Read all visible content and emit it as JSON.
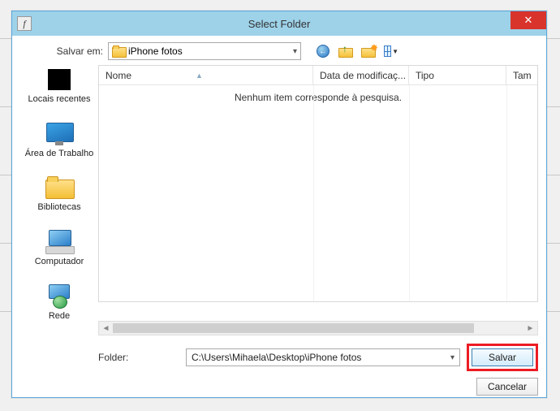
{
  "window": {
    "title": "Select Folder",
    "app_icon_glyph": "f",
    "close_glyph": "✕"
  },
  "save_in": {
    "label": "Salvar em:",
    "value": "iPhone fotos"
  },
  "toolbar": {
    "back": "←",
    "view_drop": "▼"
  },
  "places": [
    {
      "id": "recent",
      "label": "Locais recentes"
    },
    {
      "id": "desktop",
      "label": "Área de Trabalho"
    },
    {
      "id": "libraries",
      "label": "Bibliotecas"
    },
    {
      "id": "computer",
      "label": "Computador"
    },
    {
      "id": "network",
      "label": "Rede"
    }
  ],
  "columns": {
    "name": "Nome",
    "modified": "Data de modificaç...",
    "type": "Tipo",
    "size": "Tam"
  },
  "list": {
    "empty_message": "Nenhum item corresponde à pesquisa."
  },
  "folder": {
    "label": "Folder:",
    "path": "C:\\Users\\Mihaela\\Desktop\\iPhone fotos"
  },
  "buttons": {
    "save": "Salvar",
    "cancel": "Cancelar"
  }
}
